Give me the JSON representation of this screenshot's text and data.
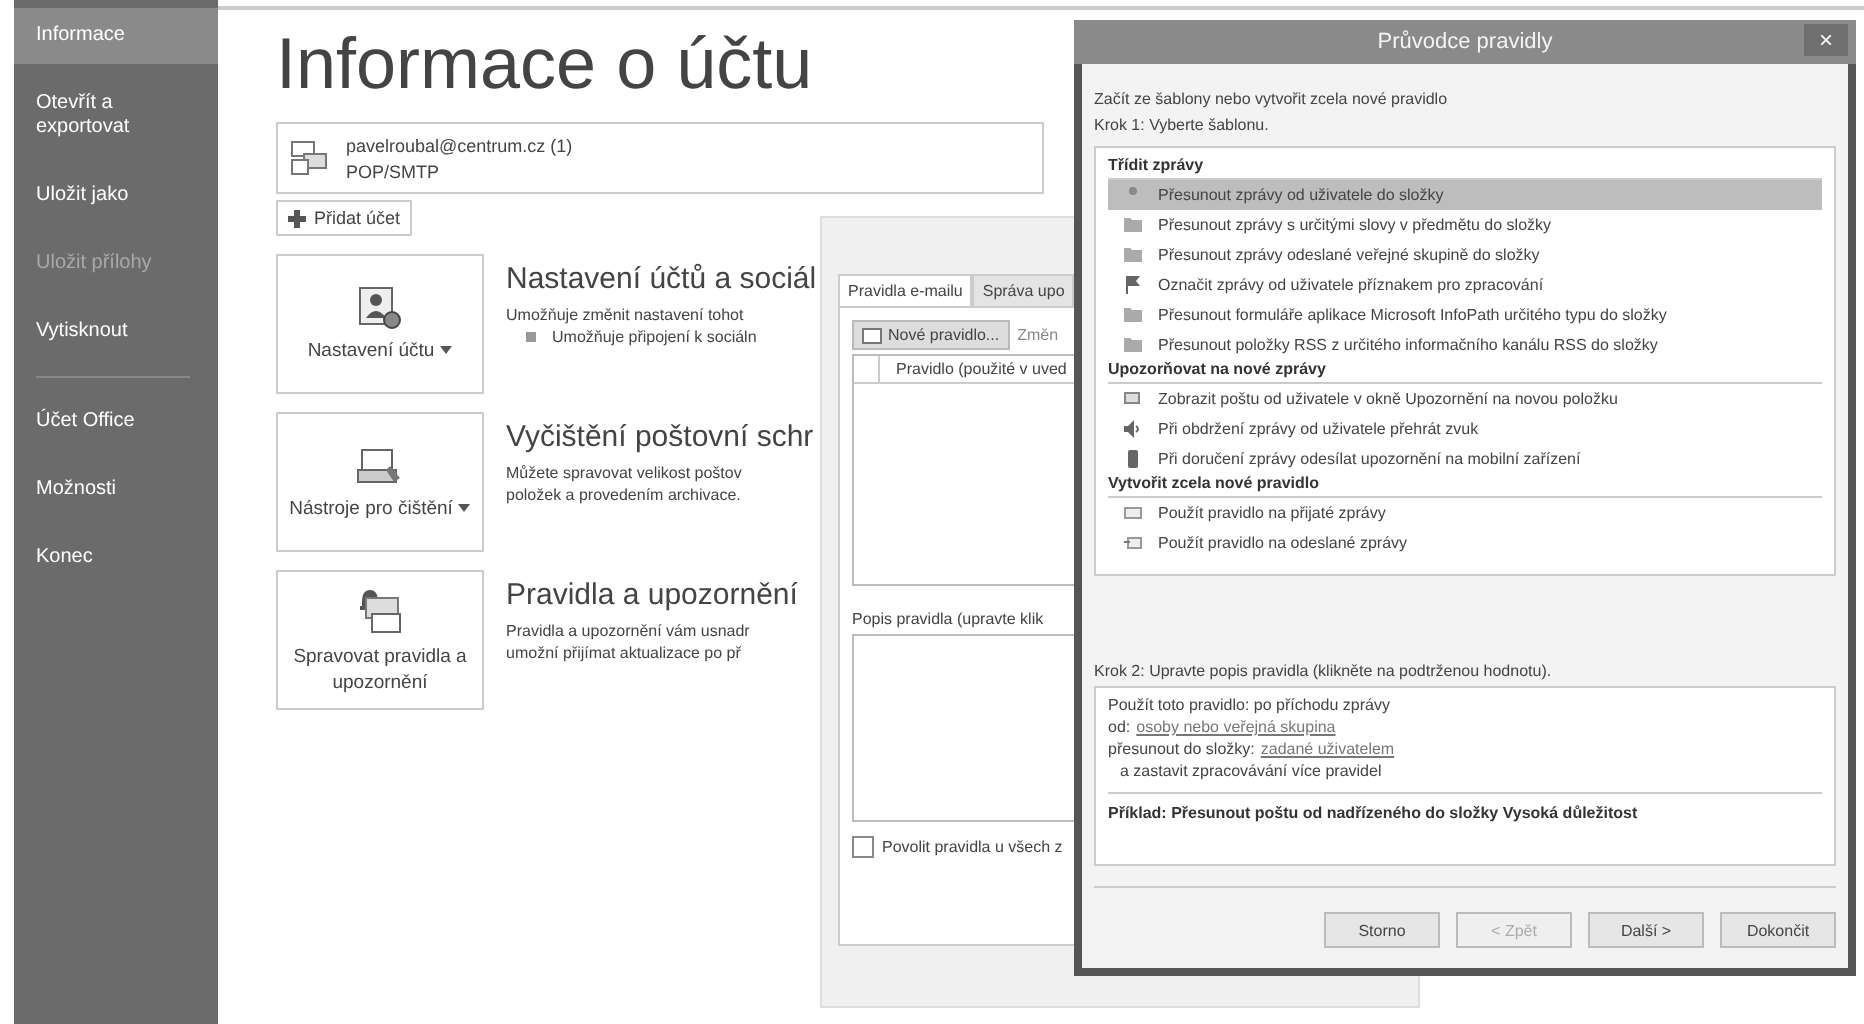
{
  "sidebar": {
    "groups": [
      [
        {
          "label": "Informace",
          "selected": true,
          "disabled": false
        },
        {
          "label": "Otevřít a exportovat",
          "selected": false,
          "disabled": false
        },
        {
          "label": "Uložit jako",
          "selected": false,
          "disabled": false
        },
        {
          "label": "Uložit přílohy",
          "selected": false,
          "disabled": true
        },
        {
          "label": "Vytisknout",
          "selected": false,
          "disabled": false
        }
      ],
      [
        {
          "label": "Účet Office",
          "selected": false,
          "disabled": false
        },
        {
          "label": "Možnosti",
          "selected": false,
          "disabled": false
        },
        {
          "label": "Konec",
          "selected": false,
          "disabled": false
        }
      ]
    ]
  },
  "page_title": "Informace o účtu",
  "account": {
    "email": "pavelroubal@centrum.cz (1)",
    "type": "POP/SMTP"
  },
  "add_account_button": "Přidat účet",
  "sections": [
    {
      "kind": "account",
      "tile_label": "Nastavení účtu",
      "dropdown": true,
      "heading": "Nastavení účtů a sociál",
      "lines": [
        "Umožňuje změnit nastavení tohot"
      ],
      "bullets": [
        "Umožňuje připojení k sociáln"
      ]
    },
    {
      "kind": "cleanup",
      "tile_label": "Nástroje pro čištění",
      "dropdown": true,
      "heading": "Vyčištění poštovní schr",
      "lines": [
        "Můžete spravovat velikost poštov",
        "položek a provedením archivace."
      ]
    },
    {
      "kind": "rules",
      "tile_label": "Spravovat pravidla a upozornění",
      "dropdown": false,
      "heading": "Pravidla a upozornění",
      "lines": [
        "Pravidla a upozornění vám usnadr",
        "umožní přijímat aktualizace po př"
      ]
    }
  ],
  "rules_dialog": {
    "tabs": [
      {
        "label": "Pravidla e-mailu",
        "selected": true
      },
      {
        "label": "Správa upo",
        "selected": false
      }
    ],
    "new_rule_button": "Nové pravidlo...",
    "change_button": "Změn",
    "column_header": "Pravidlo (použité v uved",
    "description_label": "Popis pravidla (upravte klik",
    "enable_checkbox": {
      "label": "Povolit pravidla u všech z",
      "checked": false
    }
  },
  "wizard": {
    "title": "Průvodce pravidly",
    "close": "×",
    "intro": "Začít ze šablony nebo vytvořit zcela nové pravidlo",
    "step1": "Krok 1: Vyberte šablonu.",
    "groups": [
      {
        "heading": "Třídit zprávy",
        "items": [
          {
            "kind": "person",
            "label": "Přesunout zprávy od uživatele do složky",
            "selected": true
          },
          {
            "kind": "folder",
            "label": "Přesunout zprávy s určitými slovy v předmětu do složky",
            "selected": false
          },
          {
            "kind": "folder",
            "label": "Přesunout zprávy odeslané veřejné skupině do složky",
            "selected": false
          },
          {
            "kind": "flag",
            "label": "Označit zprávy od uživatele příznakem pro zpracování",
            "selected": false
          },
          {
            "kind": "folder",
            "label": "Přesunout formuláře aplikace Microsoft InfoPath určitého typu do složky",
            "selected": false
          },
          {
            "kind": "folder",
            "label": "Přesunout položky RSS z určitého informačního kanálu RSS do složky",
            "selected": false
          }
        ]
      },
      {
        "heading": "Upozorňovat na nové zprávy",
        "items": [
          {
            "kind": "window",
            "label": "Zobrazit poštu od uživatele v okně Upozornění na novou položku",
            "selected": false
          },
          {
            "kind": "sound",
            "label": "Při obdržení zprávy od uživatele přehrát zvuk",
            "selected": false
          },
          {
            "kind": "phone",
            "label": "Při doručení zprávy odesílat upozornění na mobilní zařízení",
            "selected": false
          }
        ]
      },
      {
        "heading": "Vytvořit zcela nové pravidlo",
        "items": [
          {
            "kind": "mail",
            "label": "Použít pravidlo na přijaté zprávy",
            "selected": false
          },
          {
            "kind": "sent",
            "label": "Použít pravidlo na odeslané zprávy",
            "selected": false
          }
        ]
      }
    ],
    "step2": "Krok 2: Upravte popis pravidla (klikněte na podtrženou hodnotu).",
    "description": [
      {
        "text": "Použít toto pravidlo: po příchodu zprávy",
        "indent": false
      },
      {
        "text": "od:",
        "link": "osoby nebo veřejná skupina",
        "indent": false
      },
      {
        "text": "přesunout do složky:",
        "link": "zadané uživatelem",
        "indent": false
      },
      {
        "text": "a zastavit zpracovávání více pravidel",
        "indent": true
      }
    ],
    "example": "Příklad: Přesunout poštu od nadřízeného do složky Vysoká důležitost",
    "buttons": [
      {
        "label": "Storno",
        "disabled": false
      },
      {
        "label": "< Zpět",
        "disabled": true
      },
      {
        "label": "Další >",
        "disabled": false
      },
      {
        "label": "Dokončit",
        "disabled": false
      }
    ]
  }
}
